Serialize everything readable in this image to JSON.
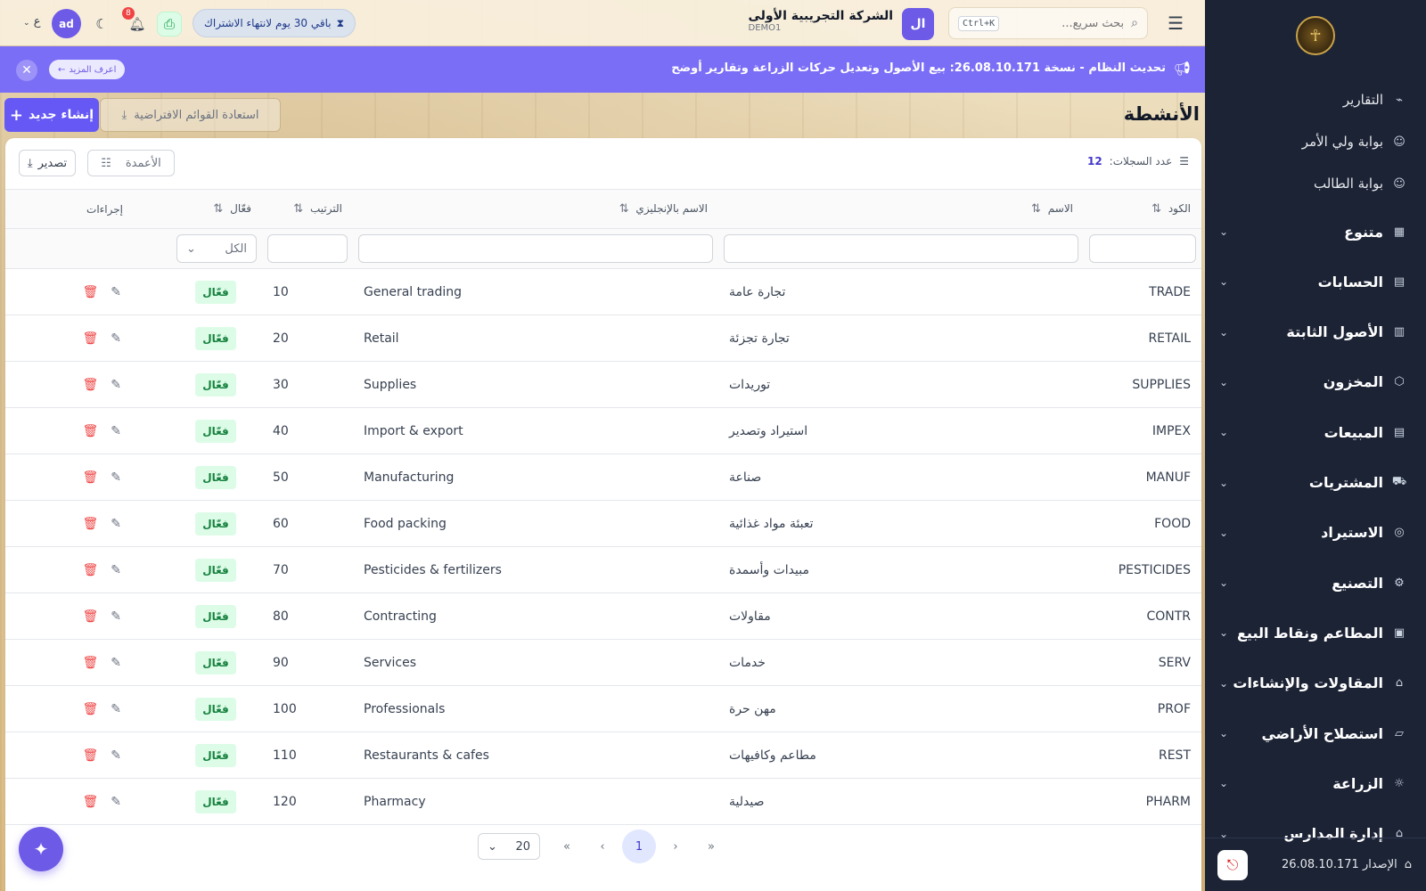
{
  "topbar": {
    "search_placeholder": "بحث سريع...",
    "search_shortcut": "Ctrl+K",
    "company_initial": "ال",
    "company_name": "الشركة التجريبية الأولى",
    "company_code": "DEMO1",
    "subscription": "باقي 30 يوم لانتهاء الاشتراك",
    "notifications_count": "8",
    "user_initials": "ad",
    "language": "ع"
  },
  "announcement": {
    "message": "تحديث النظام - نسخة 26.08.10.171: بيع الأصول وتعديل حركات الزراعة وتقارير أوضح",
    "more_label": "اعرف المزيد"
  },
  "page": {
    "title": "الأنشطة",
    "create_label": "إنشاء جديد",
    "restore_label": "استعادة القوائم الافتراضية"
  },
  "toolbar": {
    "records_label": "عدد السجلات:",
    "records_count": "12",
    "columns_label": "الأعمدة",
    "export_label": "تصدير"
  },
  "table": {
    "headers": {
      "code": "الكود",
      "name": "الاسم",
      "name_en": "الاسم بالإنجليزي",
      "order": "الترتيب",
      "active": "فعّال",
      "actions": "إجراءات"
    },
    "active_filter": "الكل",
    "rows": [
      {
        "code": "TRADE",
        "name": "تجارة عامة",
        "name_en": "General trading",
        "order": "10",
        "status": "فعّال"
      },
      {
        "code": "RETAIL",
        "name": "تجارة تجزئة",
        "name_en": "Retail",
        "order": "20",
        "status": "فعّال"
      },
      {
        "code": "SUPPLIES",
        "name": "توريدات",
        "name_en": "Supplies",
        "order": "30",
        "status": "فعّال"
      },
      {
        "code": "IMPEX",
        "name": "استيراد وتصدير",
        "name_en": "Import & export",
        "order": "40",
        "status": "فعّال"
      },
      {
        "code": "MANUF",
        "name": "صناعة",
        "name_en": "Manufacturing",
        "order": "50",
        "status": "فعّال"
      },
      {
        "code": "FOOD",
        "name": "تعبئة مواد غذائية",
        "name_en": "Food packing",
        "order": "60",
        "status": "فعّال"
      },
      {
        "code": "PESTICIDES",
        "name": "مبيدات وأسمدة",
        "name_en": "Pesticides & fertilizers",
        "order": "70",
        "status": "فعّال"
      },
      {
        "code": "CONTR",
        "name": "مقاولات",
        "name_en": "Contracting",
        "order": "80",
        "status": "فعّال"
      },
      {
        "code": "SERV",
        "name": "خدمات",
        "name_en": "Services",
        "order": "90",
        "status": "فعّال"
      },
      {
        "code": "PROF",
        "name": "مهن حرة",
        "name_en": "Professionals",
        "order": "100",
        "status": "فعّال"
      },
      {
        "code": "REST",
        "name": "مطاعم وكافيهات",
        "name_en": "Restaurants & cafes",
        "order": "110",
        "status": "فعّال"
      },
      {
        "code": "PHARM",
        "name": "صيدلية",
        "name_en": "Pharmacy",
        "order": "120",
        "status": "فعّال"
      }
    ]
  },
  "pagination": {
    "page_size": "20",
    "current_page": "1"
  },
  "sidebar": {
    "links": [
      {
        "label": "التقارير",
        "icon": "chart-icon"
      },
      {
        "label": "بوابة ولي الأمر",
        "icon": "users-icon"
      },
      {
        "label": "بوابة الطالب",
        "icon": "user-icon"
      }
    ],
    "groups": [
      {
        "label": "متنوع",
        "icon": "grid-icon"
      },
      {
        "label": "الحسابات",
        "icon": "calculator-icon"
      },
      {
        "label": "الأصول الثابتة",
        "icon": "building-icon"
      },
      {
        "label": "المخزون",
        "icon": "box-icon"
      },
      {
        "label": "المبيعات",
        "icon": "receipt-icon"
      },
      {
        "label": "المشتريات",
        "icon": "truck-icon"
      },
      {
        "label": "الاستيراد",
        "icon": "globe-icon"
      },
      {
        "label": "التصنيع",
        "icon": "gear-icon"
      },
      {
        "label": "المطاعم ونقاط البيع",
        "icon": "store-icon"
      },
      {
        "label": "المقاولات والإنشاءات",
        "icon": "bank-icon"
      },
      {
        "label": "استصلاح الأراضي",
        "icon": "map-icon"
      },
      {
        "label": "الزراعة",
        "icon": "sun-icon"
      },
      {
        "label": "إدارة المدارس",
        "icon": "school-icon"
      }
    ],
    "version_label": "الإصدار 26.08.10.171"
  }
}
